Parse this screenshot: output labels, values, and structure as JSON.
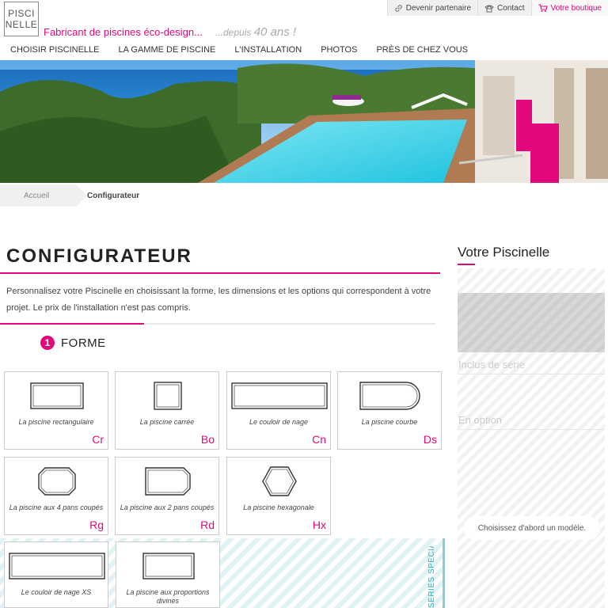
{
  "brand": {
    "logo_line1": "PISCI",
    "logo_line2": "NELLE",
    "tagline": "Fabricant de piscines éco-design...",
    "since_prefix": "...depuis",
    "since_value": "40 ans !"
  },
  "colors": {
    "accent": "#e0087c",
    "special": "#2bb5c4"
  },
  "topbar": [
    {
      "label": "Devenir partenaire",
      "icon": "link-icon"
    },
    {
      "label": "Contact",
      "icon": "phone-icon"
    },
    {
      "label": "Votre boutique",
      "icon": "cart-icon"
    }
  ],
  "nav": [
    "CHOISIR PISCINELLE",
    "LA GAMME DE PISCINE",
    "L'INSTALLATION",
    "PHOTOS",
    "PRÈS DE CHEZ VOUS"
  ],
  "breadcrumb": {
    "home": "Accueil",
    "current": "Configurateur"
  },
  "main": {
    "title": "CONFIGURATEUR",
    "intro": "Personnalisez votre Piscinelle en choisissant la forme, les dimensions et les options qui correspondent à votre projet. Le prix de l'installation n'est pas compris.",
    "progress": 0.33,
    "step_number": "1",
    "step_label": "FORME"
  },
  "shapes": [
    {
      "name": "La piscine rectangulaire",
      "code": "Cr",
      "icon": "rectangle-pool-icon"
    },
    {
      "name": "La piscine carrée",
      "code": "Bo",
      "icon": "square-pool-icon"
    },
    {
      "name": "Le couloir de nage",
      "code": "Cn",
      "icon": "lap-pool-icon"
    },
    {
      "name": "La piscine courbe",
      "code": "Ds",
      "icon": "curved-pool-icon"
    },
    {
      "name": "La piscine aux 4 pans coupés",
      "code": "Rg",
      "icon": "octagon-pool-icon"
    },
    {
      "name": "La piscine aux 2 pans coupés",
      "code": "Rd",
      "icon": "two-cut-pool-icon"
    },
    {
      "name": "La piscine hexagonale",
      "code": "Hx",
      "icon": "hexagon-pool-icon"
    },
    {
      "name": "Le couloir de nage XS",
      "code": "",
      "icon": "lap-pool-xs-icon"
    },
    {
      "name": "La piscine aux proportions divines",
      "code": "",
      "icon": "golden-pool-icon"
    }
  ],
  "special_series_label": "SÉRIES SPÉCIALES",
  "sidebar": {
    "title": "Votre Piscinelle",
    "included": "Inclus de série",
    "options": "En option",
    "choose_hint": "Choisissez d'abord un modèle."
  }
}
